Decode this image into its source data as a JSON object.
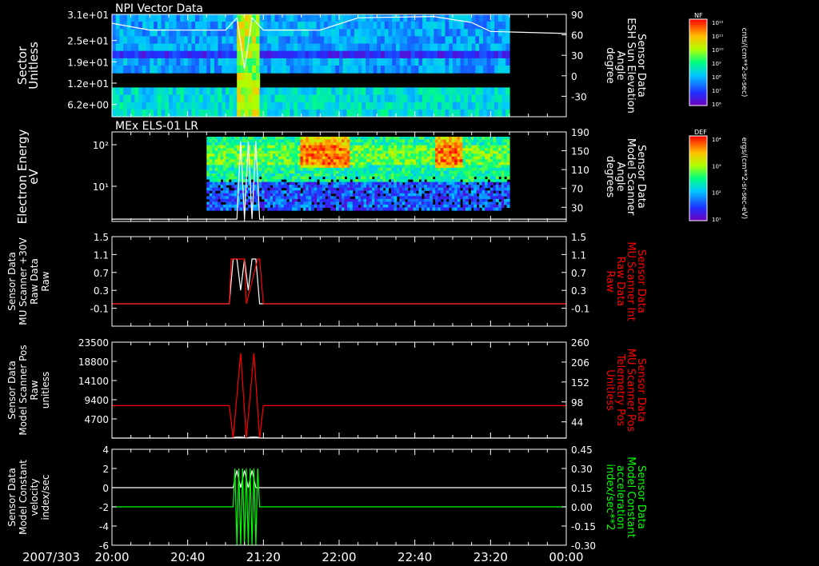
{
  "figure": {
    "date_label": "2007/303",
    "time_ticks": [
      "20:00",
      "20:40",
      "21:20",
      "22:00",
      "22:40",
      "23:20",
      "00:00"
    ]
  },
  "colorbars": [
    {
      "label": "NF",
      "units": "cnts/(cm**2-sr-sec)",
      "ticks": [
        "10¹²",
        "10¹¹",
        "10¹⁰",
        "10⁹",
        "10⁸",
        "10⁷",
        "10⁶"
      ]
    },
    {
      "label": "DEF",
      "units": "ergs/(cm**2-sr-sec-eV)",
      "ticks": [
        "10⁴",
        "10³",
        "10²",
        "10¹"
      ]
    }
  ],
  "chart_data": [
    {
      "type": "heatmap",
      "title": "NPI Vector Data",
      "ylabel": [
        "Sector",
        "Unitless"
      ],
      "y_ticks": [
        "3.1e+01",
        "2.5e+01",
        "1.9e+01",
        "1.2e+01",
        "6.2e+00"
      ],
      "ylabel_right": [
        "Sensor Data",
        "ESH Sun Elevation",
        "Angle",
        "degree"
      ],
      "y_ticks_right": [
        "90",
        "60",
        "30",
        "0",
        "-30"
      ],
      "ylim_right": [
        -60,
        90
      ],
      "colorbar": "NF",
      "overlay_line": {
        "color": "#ffffff",
        "x": [
          "20:00",
          "20:20",
          "21:00",
          "21:06",
          "21:10",
          "21:14",
          "21:20",
          "21:50",
          "22:10",
          "22:50",
          "23:10",
          "23:20",
          "00:00"
        ],
        "y": [
          77,
          67,
          67,
          85,
          10,
          85,
          67,
          67,
          85,
          87,
          78,
          65,
          62
        ]
      }
    },
    {
      "type": "heatmap",
      "title": "MEx ELS-01 LR",
      "ylabel": [
        "Electron Energy",
        "eV"
      ],
      "y_ticks": [
        "10²",
        "10¹"
      ],
      "ylabel_right": [
        "Sensor Data",
        "Model Scanner",
        "Angle",
        "degrees"
      ],
      "y_ticks_right": [
        "190",
        "150",
        "110",
        "70",
        "30"
      ],
      "ylim_right": [
        0,
        190
      ],
      "colorbar": "DEF",
      "overlay_line": {
        "color": "#ffffff",
        "x": [
          "20:00",
          "21:06",
          "21:08",
          "21:10",
          "21:12",
          "21:14",
          "21:16",
          "21:18",
          "00:00"
        ],
        "y": [
          5,
          5,
          170,
          5,
          170,
          5,
          170,
          5,
          5
        ]
      }
    },
    {
      "type": "line",
      "ylabel": [
        "Sensor Data",
        "MU Scanner +30V",
        "Raw Data",
        "Raw"
      ],
      "y_ticks": [
        "1.5",
        "1.1",
        "0.7",
        "0.3",
        "-0.1"
      ],
      "ylim": [
        -0.5,
        1.5
      ],
      "ylabel_right": [
        "Sensor Data",
        "MU Scanner Int",
        "Raw Data",
        "Raw"
      ],
      "ylabel_right_color": "#ff0000",
      "y_ticks_right": [
        "1.5",
        "1.1",
        "0.7",
        "0.3",
        "-0.1"
      ],
      "ylim_right": [
        -0.5,
        1.5
      ],
      "series": [
        {
          "color": "#ffffff",
          "x": [
            "20:00",
            "21:02",
            "21:04",
            "21:06",
            "21:08",
            "21:10",
            "21:12",
            "21:14",
            "21:16",
            "21:18",
            "00:00"
          ],
          "y": [
            0.0,
            0.0,
            1.0,
            1.0,
            0.3,
            1.0,
            0.3,
            1.0,
            1.0,
            0.0,
            0.0
          ]
        },
        {
          "color": "#ff0000",
          "x": [
            "20:00",
            "21:02",
            "21:03",
            "21:10",
            "21:11",
            "21:17",
            "21:18",
            "21:20",
            "23:20",
            "00:00"
          ],
          "y": [
            0.0,
            0.0,
            1.0,
            1.0,
            0.0,
            1.0,
            1.0,
            0.0,
            0.0,
            0.0
          ]
        }
      ]
    },
    {
      "type": "line",
      "ylabel": [
        "Sensor Data",
        "Model Scanner Pos",
        "Raw",
        "unitless"
      ],
      "y_ticks": [
        "23500",
        "18800",
        "14100",
        "9400",
        "4700"
      ],
      "ylim": [
        0,
        23500
      ],
      "ylabel_right": [
        "Sensor Data",
        "MU Scanner Pos",
        "Telemetry Pos",
        "Unitless"
      ],
      "ylabel_right_color": "#ff0000",
      "y_ticks_right": [
        "260",
        "206",
        "152",
        "98",
        "44"
      ],
      "ylim_right": [
        0,
        260
      ],
      "series": [
        {
          "color": "#ffffff",
          "x": [
            "20:00",
            "21:03",
            "21:05",
            "21:07",
            "21:09",
            "21:11",
            "21:13",
            "21:15",
            "21:17",
            "21:19",
            "00:00"
          ],
          "y": [
            0,
            0,
            200,
            250,
            200,
            0,
            200,
            250,
            200,
            0,
            0
          ]
        },
        {
          "color": "#ff0000",
          "x": [
            "20:00",
            "21:02",
            "21:04",
            "21:08",
            "21:11",
            "21:15",
            "21:18",
            "21:20",
            "00:00"
          ],
          "y": [
            88,
            88,
            0,
            230,
            0,
            230,
            0,
            88,
            88
          ]
        }
      ]
    },
    {
      "type": "line",
      "ylabel": [
        "Sensor Data",
        "Model Constant",
        "velocity",
        "index/sec"
      ],
      "y_ticks": [
        "4",
        "2",
        "0",
        "-2",
        "-4",
        "-6"
      ],
      "ylim": [
        -6,
        4
      ],
      "ylabel_right": [
        "Sensor Data",
        "Model Constant",
        "acceleration",
        "index/sec**2"
      ],
      "ylabel_right_color": "#00ff00",
      "y_ticks_right": [
        "0.45",
        "0.30",
        "0.15",
        "0.00",
        "-0.15",
        "-0.30"
      ],
      "ylim_right": [
        -0.3,
        0.45
      ],
      "series": [
        {
          "color": "#ffffff",
          "x": [
            "20:00",
            "21:04",
            "21:06",
            "21:08",
            "21:10",
            "21:12",
            "21:14",
            "21:16",
            "21:18",
            "00:00"
          ],
          "y": [
            0,
            0,
            1.8,
            0,
            1.8,
            0,
            1.8,
            0,
            0,
            0
          ]
        },
        {
          "color": "#00ff00",
          "x": [
            "20:00",
            "21:04",
            "21:05",
            "21:06",
            "21:07",
            "21:08",
            "21:09",
            "21:10",
            "21:11",
            "21:12",
            "21:13",
            "21:14",
            "21:15",
            "21:16",
            "21:17",
            "21:18",
            "00:00"
          ],
          "y": [
            0,
            0,
            0.3,
            -0.3,
            0.3,
            -0.3,
            0.3,
            -0.3,
            0.3,
            -0.3,
            0.3,
            -0.3,
            0.3,
            -0.3,
            0.3,
            0,
            0
          ]
        }
      ]
    }
  ]
}
